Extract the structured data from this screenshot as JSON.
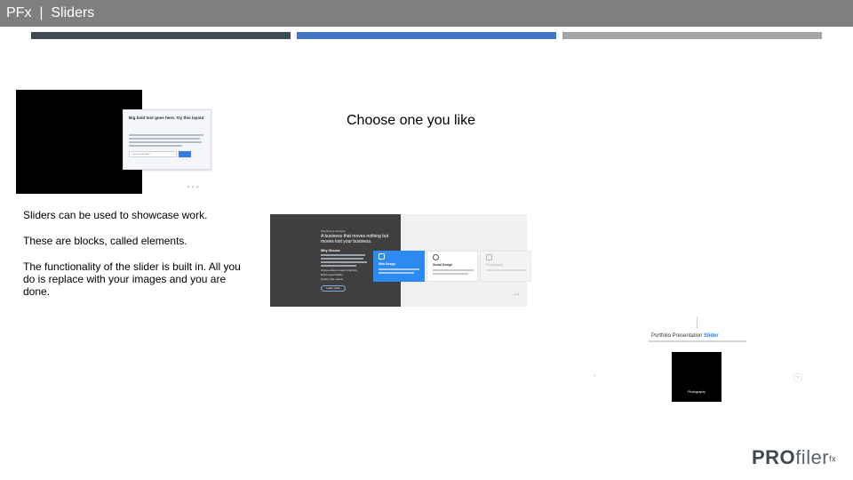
{
  "header": {
    "title": "PFx  |  Sliders"
  },
  "colors": {
    "header_bg": "#7f7f7f",
    "stripe_dark": "#404a54",
    "stripe_blue": "#4472c4",
    "stripe_grey": "#a5a5a5"
  },
  "main": {
    "heading": "Choose one you like",
    "paragraphs": [
      "Sliders can be used to showcase work.",
      "These are blocks, called elements.",
      "The functionality of the slider is built in. All you do is replace with your images and you are done."
    ]
  },
  "slider1": {
    "card_title": "Big bold text goes here. Try this layout",
    "input_placeholder": "Your email here"
  },
  "slider2": {
    "kicker": "Solutions & Services",
    "headline": "A business that moves nothing but moves lost your business.",
    "subhead": "Why Choose",
    "bullets": [
      "Unique about modern inspiring",
      "Build responsibility",
      "Quality that means"
    ],
    "button": "Learn more",
    "cards": [
      "Web Design",
      "Social Design",
      "Photography"
    ]
  },
  "slider3": {
    "title_prefix": "Portfolio Presentation",
    "title_accent": "Slider",
    "caption": "Photography"
  },
  "logo": {
    "bold": "PRO",
    "light": "filer",
    "sup": "fx"
  }
}
